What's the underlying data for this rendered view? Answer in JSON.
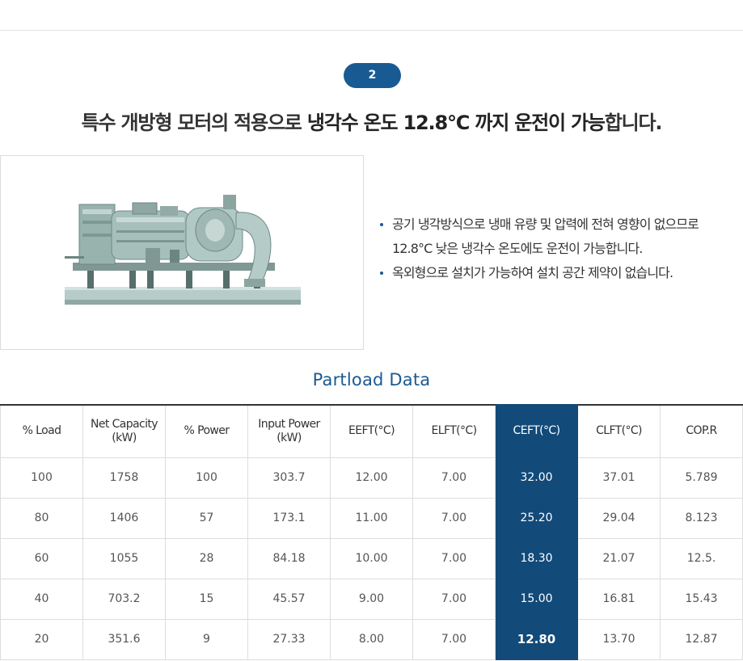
{
  "step": {
    "number": "2"
  },
  "headline": {
    "normal": "특수 개방형 모터의 적용으로 ",
    "bold": "냉각수 온도 12.8°C 까지 운전이 가능",
    "tail": "합니다."
  },
  "bullets": [
    "공기 냉각방식으로 냉매 유량 및 압력에 전혀 영향이 없으므로 12.8°C 낮은 냉각수 온도에도 운전이 가능합니다.",
    "옥외형으로 설치가 가능하여 설치 공간 제약이 없습니다."
  ],
  "section": {
    "title": "Partload Data"
  },
  "table": {
    "headers": [
      "% Load",
      "Net Capacity\n(kW)",
      "% Power",
      "Input Power\n(kW)",
      "EEFT(°C)",
      "ELFT(°C)",
      "CEFT(°C)",
      "CLFT(°C)",
      "COP.R"
    ],
    "highlight_column": 6,
    "rows": [
      [
        "100",
        "1758",
        "100",
        "303.7",
        "12.00",
        "7.00",
        "32.00",
        "37.01",
        "5.789"
      ],
      [
        "80",
        "1406",
        "57",
        "173.1",
        "11.00",
        "7.00",
        "25.20",
        "29.04",
        "8.123"
      ],
      [
        "60",
        "1055",
        "28",
        "84.18",
        "10.00",
        "7.00",
        "18.30",
        "21.07",
        "12.5."
      ],
      [
        "40",
        "703.2",
        "15",
        "45.57",
        "9.00",
        "7.00",
        "15.00",
        "16.81",
        "15.43"
      ],
      [
        "20",
        "351.6",
        "9",
        "27.33",
        "8.00",
        "7.00",
        "12.80",
        "13.70",
        "12.87"
      ]
    ]
  },
  "colors": {
    "accent": "#1a5a93",
    "highlight_column": "#124a7a",
    "machine": "#a9c2be"
  },
  "image": {
    "subject": "chiller-unit-illustration"
  }
}
